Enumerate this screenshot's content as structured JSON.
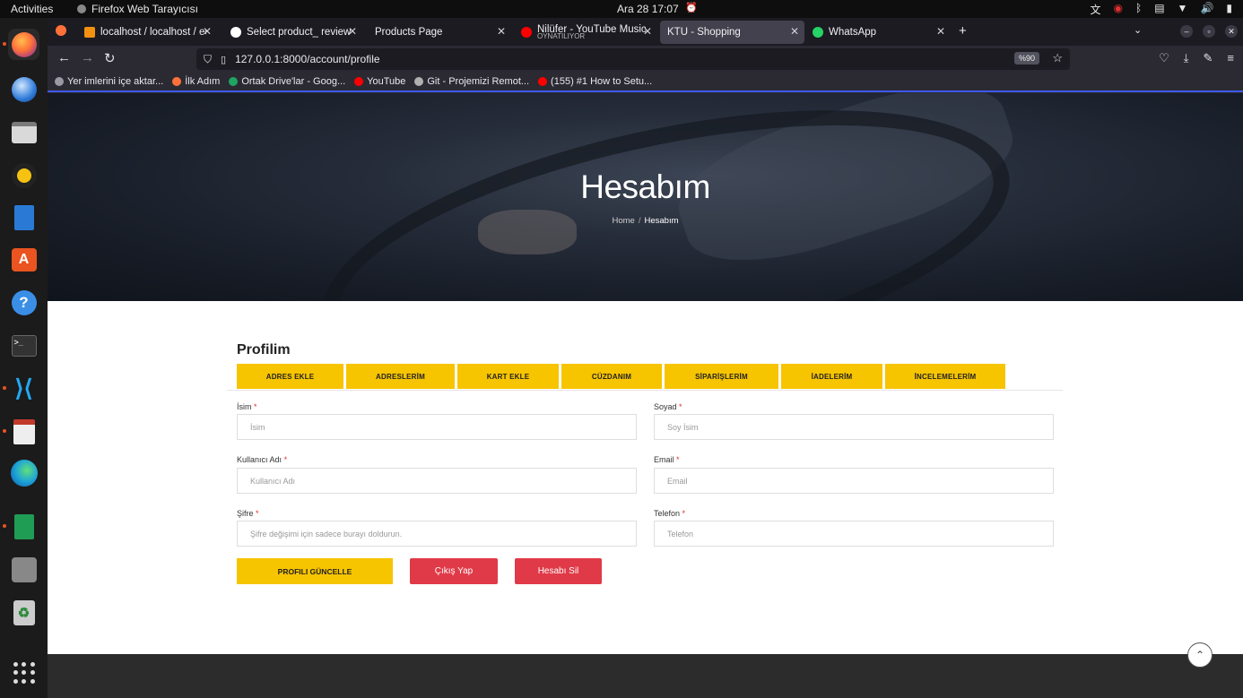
{
  "system": {
    "activities": "Activities",
    "app_name": "Firefox Web Tarayıcısı",
    "clock": "Ara 28  17:07"
  },
  "browser": {
    "tabs": [
      {
        "title": "localhost / localhost / ecc",
        "color": "#f29111"
      },
      {
        "title": "Select product_ review tc",
        "color": "#ffffff"
      },
      {
        "title": "Products Page",
        "color": ""
      },
      {
        "title": "Nilüfer - YouTube Music",
        "subtitle": "OYNATILIYOR",
        "color": "#ff0000"
      },
      {
        "title": "KTU - Shopping",
        "color": "",
        "active": true
      },
      {
        "title": "WhatsApp",
        "color": "#25d366"
      }
    ],
    "url": "127.0.0.1:8000/account/profile",
    "zoom": "%90",
    "bookmarks": [
      {
        "label": "Yer imlerini içe aktar...",
        "color": "#9a9aa5"
      },
      {
        "label": "İlk Adım",
        "color": "#ff7139"
      },
      {
        "label": "Ortak Drive'lar - Goog...",
        "color": "#1fa463"
      },
      {
        "label": "YouTube",
        "color": "#ff0000"
      },
      {
        "label": "Git - Projemizi Remot...",
        "color": "#b0b0b0"
      },
      {
        "label": "(155) #1 How to Setu...",
        "color": "#ff0000"
      }
    ]
  },
  "hero": {
    "title": "Hesabım",
    "breadcrumb_home": "Home",
    "breadcrumb_sep": "/",
    "breadcrumb_current": "Hesabım"
  },
  "profile": {
    "heading": "Profilim",
    "tabs": [
      "ADRES EKLE",
      "ADRESLERİM",
      "KART EKLE",
      "CÜZDANIM",
      "SİPARİŞLERİM",
      "İADELERİM",
      "İNCELEMELERİM"
    ],
    "fields": {
      "first_name": {
        "label": "İsim",
        "placeholder": "İsim"
      },
      "last_name": {
        "label": "Soyad",
        "placeholder": "Soy İsim"
      },
      "username": {
        "label": "Kullanıcı Adı",
        "placeholder": "Kullanıcı Adı"
      },
      "email": {
        "label": "Email",
        "placeholder": "Email"
      },
      "password": {
        "label": "Şifre",
        "placeholder": "Şifre değişimi için sadece burayı doldurun."
      },
      "phone": {
        "label": "Telefon",
        "placeholder": "Telefon"
      }
    },
    "required_mark": "*",
    "buttons": {
      "update": "PROFILI GÜNCELLE",
      "logout": "Çıkış Yap",
      "delete": "Hesabı Sil"
    }
  },
  "colors": {
    "accent_yellow": "#f7c400",
    "danger_red": "#e03a48"
  }
}
